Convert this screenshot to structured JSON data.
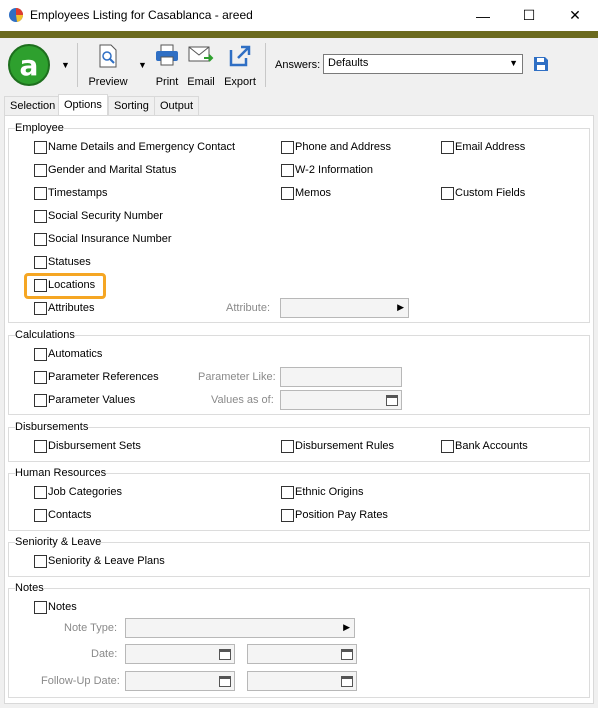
{
  "window": {
    "title": "Employees Listing for Casablanca - areed",
    "minimize": "—",
    "maximize": "☐",
    "close": "✕"
  },
  "colors": {
    "accent": "#6b6a1e",
    "logo": "#2ea02e",
    "highlight": "#f5a623"
  },
  "toolbar": {
    "logo_letter": "a",
    "preview": "Preview",
    "print": "Print",
    "email": "Email",
    "export": "Export",
    "answers_label": "Answers:",
    "answers_value": "Defaults"
  },
  "tabs": [
    "Selection",
    "Options",
    "Sorting",
    "Output"
  ],
  "groups": {
    "employee": {
      "title": "Employee",
      "items": {
        "name_details": "Name Details and Emergency Contact",
        "gender": "Gender and Marital Status",
        "timestamps": "Timestamps",
        "ssn": "Social Security Number",
        "sin": "Social Insurance Number",
        "statuses": "Statuses",
        "locations": "Locations",
        "attributes": "Attributes",
        "phone": "Phone and Address",
        "w2": "W-2 Information",
        "memos": "Memos",
        "email": "Email Address",
        "custom_fields": "Custom Fields"
      },
      "attribute_label": "Attribute:"
    },
    "calculations": {
      "title": "Calculations",
      "automatics": "Automatics",
      "param_refs": "Parameter References",
      "param_values": "Parameter Values",
      "param_like_label": "Parameter Like:",
      "values_as_of_label": "Values as of:"
    },
    "disbursements": {
      "title": "Disbursements",
      "sets": "Disbursement Sets",
      "rules": "Disbursement Rules",
      "bank": "Bank Accounts"
    },
    "hr": {
      "title": "Human Resources",
      "job_categories": "Job Categories",
      "contacts": "Contacts",
      "ethnic": "Ethnic Origins",
      "position_pay": "Position Pay Rates"
    },
    "seniority": {
      "title": "Seniority & Leave",
      "plans": "Seniority & Leave Plans"
    },
    "notes": {
      "title": "Notes",
      "notes": "Notes",
      "note_type_label": "Note Type:",
      "date_label": "Date:",
      "followup_label": "Follow-Up Date:"
    }
  }
}
